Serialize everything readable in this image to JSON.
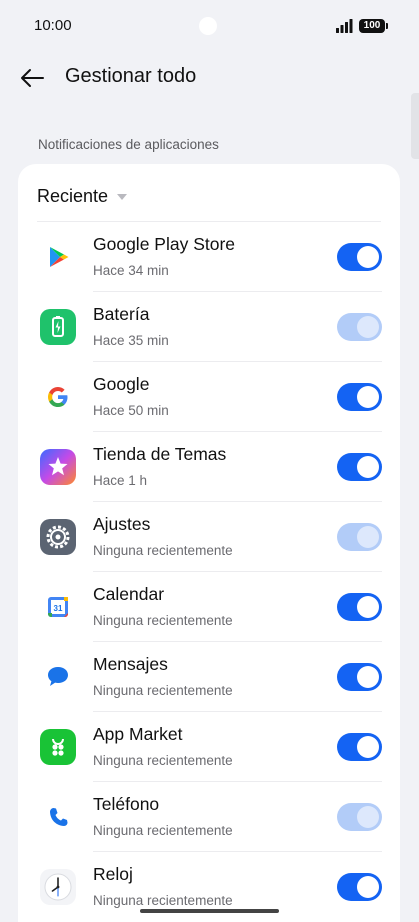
{
  "status_bar": {
    "time": "10:00",
    "battery": "100"
  },
  "header": {
    "title": "Gestionar todo",
    "back_icon": "arrow-left-icon"
  },
  "section": {
    "label": "Notificaciones de aplicaciones"
  },
  "sort": {
    "label": "Reciente"
  },
  "colors": {
    "accent": "#1463f3",
    "toggle_disabled": "#b2ccf8",
    "background": "#f1f2f6",
    "card": "#ffffff"
  },
  "apps": [
    {
      "name": "Google Play Store",
      "subtitle": "Hace 34 min",
      "icon": "google-play-store-icon",
      "enabled": true,
      "locked": false
    },
    {
      "name": "Batería",
      "subtitle": "Hace 35 min",
      "icon": "battery-app-icon",
      "enabled": true,
      "locked": true
    },
    {
      "name": "Google",
      "subtitle": "Hace 50 min",
      "icon": "google-icon",
      "enabled": true,
      "locked": false
    },
    {
      "name": "Tienda de Temas",
      "subtitle": "Hace 1 h",
      "icon": "theme-store-icon",
      "enabled": true,
      "locked": false
    },
    {
      "name": "Ajustes",
      "subtitle": "Ninguna recientemente",
      "icon": "settings-icon",
      "enabled": true,
      "locked": true
    },
    {
      "name": "Calendar",
      "subtitle": "Ninguna recientemente",
      "icon": "calendar-icon",
      "enabled": true,
      "locked": false
    },
    {
      "name": "Mensajes",
      "subtitle": "Ninguna recientemente",
      "icon": "messages-icon",
      "enabled": true,
      "locked": false
    },
    {
      "name": "App Market",
      "subtitle": "Ninguna recientemente",
      "icon": "app-market-icon",
      "enabled": true,
      "locked": false
    },
    {
      "name": "Teléfono",
      "subtitle": "Ninguna recientemente",
      "icon": "phone-icon",
      "enabled": true,
      "locked": true
    },
    {
      "name": "Reloj",
      "subtitle": "Ninguna recientemente",
      "icon": "clock-icon",
      "enabled": true,
      "locked": false
    }
  ]
}
